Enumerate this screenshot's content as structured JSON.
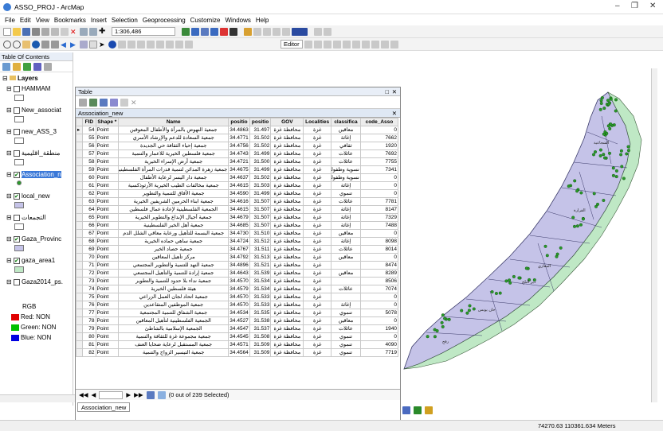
{
  "window": {
    "title": "ASSO_PROJ - ArcMap"
  },
  "menu": [
    "File",
    "Edit",
    "View",
    "Bookmarks",
    "Insert",
    "Selection",
    "Geoprocessing",
    "Customize",
    "Windows",
    "Help"
  ],
  "toolbar": {
    "scale": "1:306,486",
    "editor_label": "Editor"
  },
  "toc": {
    "header": "Table Of Contents",
    "layers_root": "Layers",
    "layers": [
      {
        "name": "HAMMAM",
        "checked": false
      },
      {
        "name": "New_associat",
        "checked": false
      },
      {
        "name": "new_ASS_3",
        "checked": false
      },
      {
        "name": "منطقة_اقليمية",
        "checked": false
      },
      {
        "name": "Association_n",
        "checked": true
      },
      {
        "name": "local_new",
        "checked": true
      },
      {
        "name": "التجمعات",
        "checked": false
      },
      {
        "name": "Gaza_Provinc",
        "checked": true
      },
      {
        "name": "gaza_area1",
        "checked": true
      },
      {
        "name": "Gaza2014_ps.",
        "checked": false
      }
    ],
    "rgb_label": "RGB",
    "bands": [
      {
        "label": "Red:  NON",
        "color": "#e00000"
      },
      {
        "label": "Green: NON",
        "color": "#00c000"
      },
      {
        "label": "Blue:  NON",
        "color": "#0000e0"
      }
    ]
  },
  "table_window": {
    "title": "Table",
    "subtab": "Association_new",
    "columns": [
      "FID",
      "Shape *",
      "Name",
      "positio",
      "positio",
      "GOV",
      "Localities",
      "classifica",
      "code_Asso"
    ],
    "rows": [
      [
        "54",
        "Point",
        "جمعية النهوض بالمرأة والأطفال المعوقين",
        "34.4863",
        "31.497",
        "محافظة غزة",
        "غزة",
        "معاقين",
        "0"
      ],
      [
        "55",
        "Point",
        "جمعية السعادة للدعم والإرشاد الأسري",
        "34.4771",
        "31.502",
        "محافظة غزة",
        "غزة",
        "إغاثة",
        "7662"
      ],
      [
        "56",
        "Point",
        "جمعية إحياء الثقافة حي الجديدة",
        "34.4756",
        "31.502",
        "محافظة غزة",
        "غزة",
        "ثقافي",
        "1920"
      ],
      [
        "57",
        "Point",
        "جمعية فلسطين الخيرية للاعمار والتنمية",
        "34.4743",
        "31.499",
        "محافظة غزة",
        "غزة",
        "عائلات",
        "7692"
      ],
      [
        "58",
        "Point",
        "جمعية أرض الإسراء الخيرية",
        "34.4721",
        "31.500",
        "محافظة غزة",
        "غزة",
        "عائلات",
        "7755"
      ],
      [
        "59",
        "Point",
        "جمعية زهرة المدائن لتنمية قدرات المرأة الفلسطينية",
        "34.4675",
        "31.499",
        "محافظة غزة",
        "غزة",
        "نسوية وطفولة",
        "7341"
      ],
      [
        "60",
        "Point",
        "جمعية دار اليسر لرعاية الأطفال",
        "34.4637",
        "31.502",
        "محافظة غزة",
        "غزة",
        "نسوية وطفولة",
        "0"
      ],
      [
        "61",
        "Point",
        "جمعية مخالفات الطيب الخيرية الأرثوذكسية",
        "34.4615",
        "31.503",
        "محافظة غزة",
        "غزة",
        "إغاثة",
        "0"
      ],
      [
        "62",
        "Point",
        "جمعية الأفاق للتنمية والتطوير",
        "34.4590",
        "31.499",
        "محافظة غزة",
        "غزة",
        "تنموي",
        "0"
      ],
      [
        "63",
        "Point",
        "جمعية ابناء الحرمين الشريفين الخيرية",
        "34.4616",
        "31.507",
        "محافظة غزة",
        "غزة",
        "عائلات",
        "7781"
      ],
      [
        "64",
        "Point",
        "الجمعية الفلسطينية لإعادة عمال فلسطين",
        "34.4615",
        "31.507",
        "محافظة غزة",
        "غزة",
        "إغاثة",
        "8147"
      ],
      [
        "65",
        "Point",
        "جمعية أجيال الإبداع والتطوير الخيرية",
        "34.4679",
        "31.507",
        "محافظة غزة",
        "غزة",
        "إغاثة",
        "7329"
      ],
      [
        "66",
        "Point",
        "جمعية أهل الخير الفلسطينية",
        "34.4685",
        "31.507",
        "محافظة غزة",
        "غزة",
        "إغاثة",
        "7488"
      ],
      [
        "67",
        "Point",
        "جمعية البسمة للتأهيل ورعاية معاقي الشلل الدم",
        "34.4730",
        "31.510",
        "محافظة غزة",
        "غزة",
        "معاقين",
        "0"
      ],
      [
        "68",
        "Point",
        "جمعية ساهي حماده الخيرية",
        "34.4724",
        "31.512",
        "محافظة غزة",
        "غزة",
        "إغاثة",
        "8098"
      ],
      [
        "69",
        "Point",
        "جمعية حصاد الخير",
        "34.4767",
        "31.511",
        "محافظة غزة",
        "غزة",
        "عائلات",
        "8014"
      ],
      [
        "70",
        "Point",
        "مركز تأهيل المعاقين",
        "34.4792",
        "31.513",
        "محافظة غزة",
        "غزة",
        "معاقين",
        "0"
      ],
      [
        "71",
        "Point",
        "جمعية النهد للتنمية والتطوير المجتمعي",
        "34.4896",
        "31.521",
        "محافظة غزة",
        "غزة",
        "",
        "8474"
      ],
      [
        "72",
        "Point",
        "جمعية إرادة للتنمية والتأهيل المجتمعي",
        "34.4643",
        "31.539",
        "محافظة غزة",
        "غزة",
        "معاقين",
        "8289"
      ],
      [
        "73",
        "Point",
        "جمعية نداء بلا حدود للتنمية والتطوير",
        "34.4570",
        "31.534",
        "محافظة غزة",
        "غزة",
        "",
        "8506"
      ],
      [
        "74",
        "Point",
        "هيئة فلسطين الخيرية",
        "34.4579",
        "31.534",
        "محافظة غزة",
        "غزة",
        "عائلات",
        "7074"
      ],
      [
        "75",
        "Point",
        "جمعية اتحاد لجان العمل الزراعي",
        "34.4570",
        "31.533",
        "محافظة غزة",
        "غزة",
        "",
        "0"
      ],
      [
        "76",
        "Point",
        "جمعية الموظفين المتقاعدين",
        "34.4570",
        "31.533",
        "محافظة غزة",
        "غزة",
        "إغاثة",
        "0"
      ],
      [
        "77",
        "Point",
        "جمعية الشفاق للتنمية المجتمعية",
        "34.4534",
        "31.535",
        "محافظة غزة",
        "غزة",
        "تنموي",
        "5078"
      ],
      [
        "78",
        "Point",
        "الجمعية الفلسطينية لتأهيل المعاقين",
        "34.4527",
        "31.538",
        "محافظة غزة",
        "غزة",
        "معاقين",
        "0"
      ],
      [
        "79",
        "Point",
        "الجمعية الإسلامية بالشاطئ",
        "34.4547",
        "31.537",
        "محافظة غزة",
        "غزة",
        "عائلات",
        "1940"
      ],
      [
        "80",
        "Point",
        "جمعية مجموعة غزة للثقافة والتنمية",
        "34.4545",
        "31.508",
        "محافظة غزة",
        "غزة",
        "تنموي",
        "0"
      ],
      [
        "81",
        "Point",
        "جمعية المستقبل لرعاية ضحايا العنف",
        "34.4571",
        "31.509",
        "محافظة غزة",
        "غزة",
        "تنموي",
        "4090"
      ],
      [
        "82",
        "Point",
        "جمعية التيسير الزواج والتنمية",
        "34.4564",
        "31.509",
        "محافظة غزة",
        "غزة",
        "تنموي",
        "7719"
      ]
    ],
    "nav_status": "(0 out of 239 Selected)",
    "bottom_tab": "Association_new"
  },
  "status_bar": {
    "coords": "74270.63  110361.634 Meters"
  },
  "map_labels": [
    "الشجاعية",
    "القرارة",
    "المغازي",
    "دير البلح",
    "رفح",
    "خان يونس"
  ]
}
